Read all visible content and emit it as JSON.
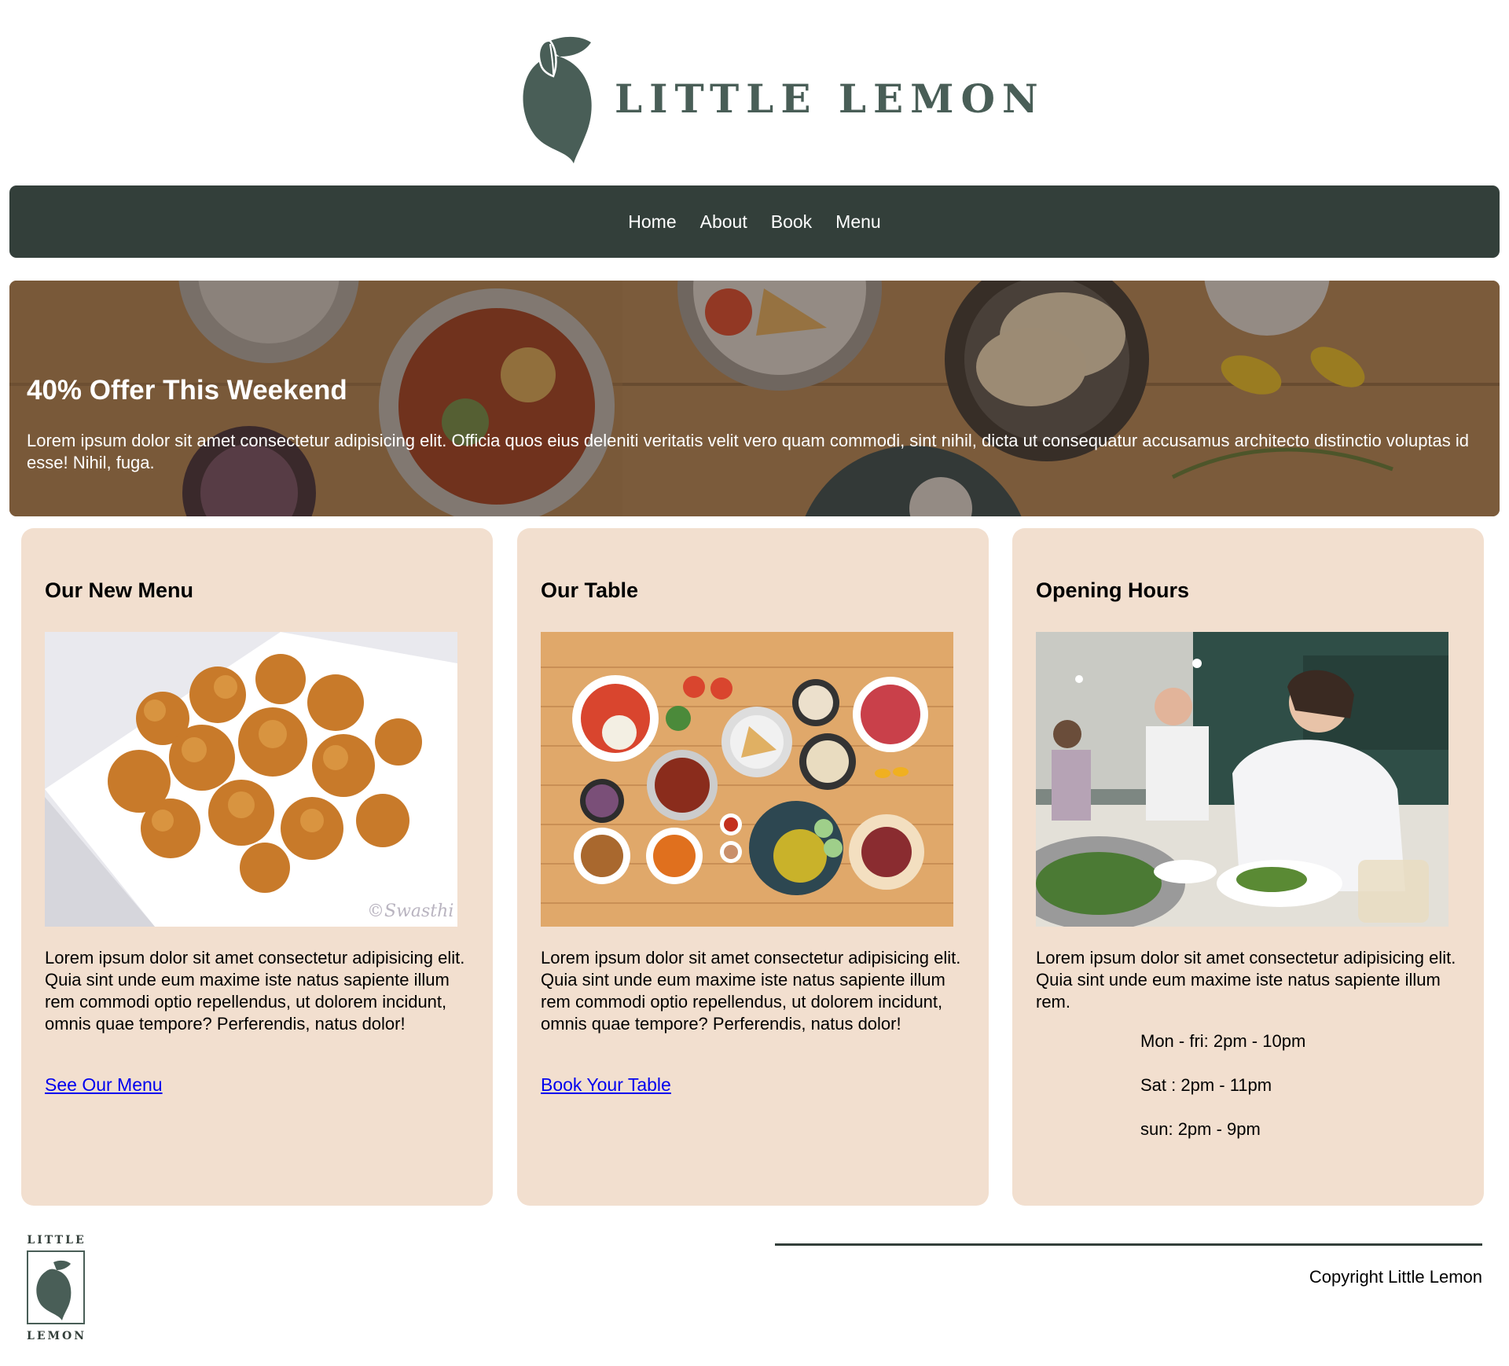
{
  "brand": {
    "name": "LITTLE LEMON",
    "footer_top": "LITTLE",
    "footer_bottom": "LEMON"
  },
  "nav": {
    "items": [
      "Home",
      "About",
      "Book",
      "Menu"
    ]
  },
  "hero": {
    "title": "40% Offer This Weekend",
    "text": "Lorem ipsum dolor sit amet consectetur adipisicing elit. Officia quos eius deleniti veritatis velit vero quam commodi, sint nihil, dicta ut consequatur accusamus architecto distinctio voluptas id esse! Nihil, fuga."
  },
  "cards": [
    {
      "title": "Our New Menu",
      "image": "fried-food-photo",
      "watermark": "©Swasthi",
      "text": "Lorem ipsum dolor sit amet consectetur adipisicing elit. Quia sint unde eum maxime iste natus sapiente illum rem commodi optio repellendus, ut dolorem incidunt, omnis quae tempore? Perferendis, natus dolor!",
      "link": "See Our Menu"
    },
    {
      "title": "Our Table",
      "image": "table-dishes-illustration",
      "text": "Lorem ipsum dolor sit amet consectetur adipisicing elit. Quia sint unde eum maxime iste natus sapiente illum rem commodi optio repellendus, ut dolorem incidunt, omnis quae tempore? Perferendis, natus dolor!",
      "link": "Book Your Table"
    },
    {
      "title": "Opening Hours",
      "image": "chef-kitchen-photo",
      "text": "Lorem ipsum dolor sit amet consectetur adipisicing elit. Quia sint unde eum maxime iste natus sapiente illum rem.",
      "hours": [
        "Mon - fri: 2pm - 10pm",
        "Sat : 2pm - 11pm",
        "sun: 2pm - 9pm"
      ]
    }
  ],
  "footer": {
    "copyright": "Copyright Little Lemon"
  },
  "colors": {
    "brand_green": "#495e57",
    "nav_bg": "#333f3a",
    "card_bg": "#f2dfcf",
    "link": "#0000ee"
  }
}
